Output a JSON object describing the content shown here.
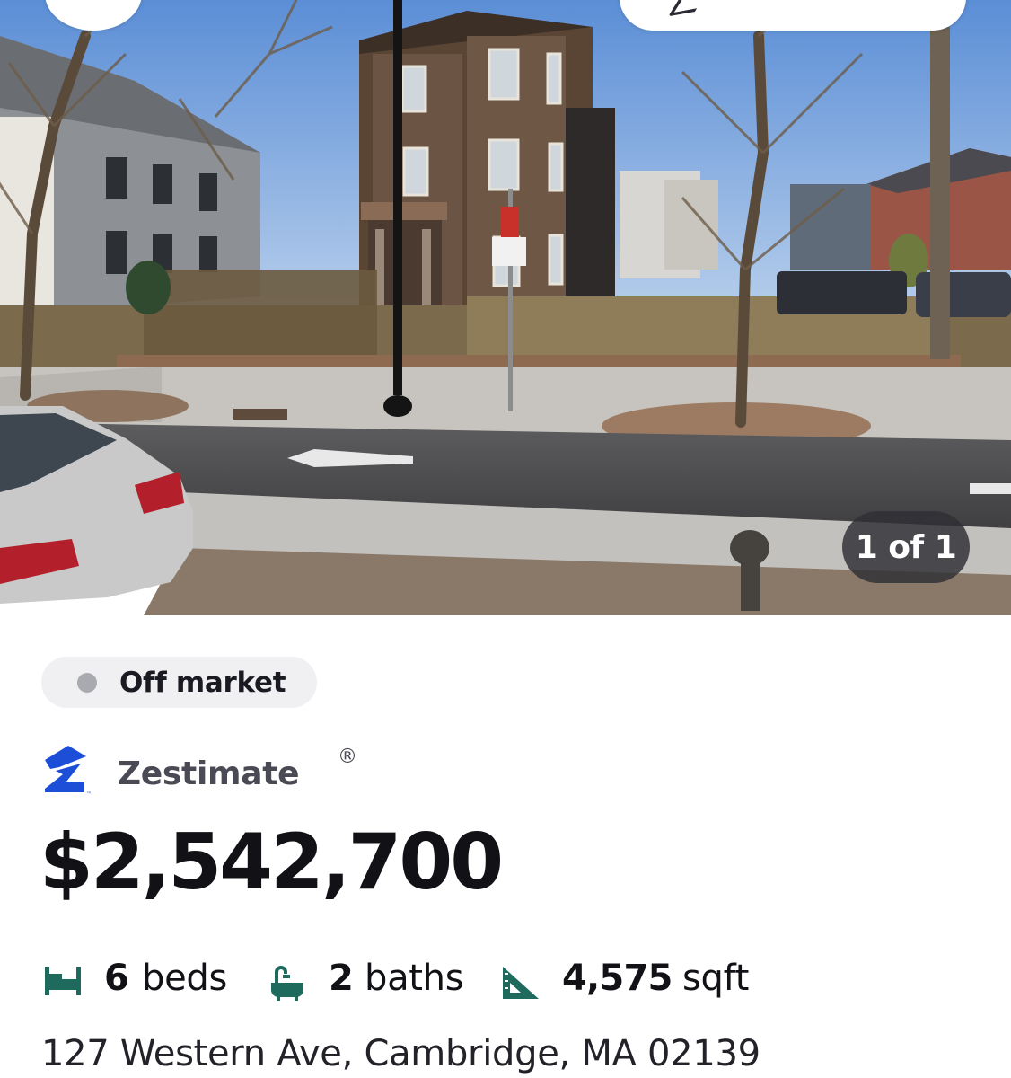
{
  "photo": {
    "counter_text": "1 of 1",
    "description_icon": "listing-photo"
  },
  "status": {
    "label": "Off market",
    "dot_color": "#a9a9b0"
  },
  "zestimate": {
    "label": "Zestimate",
    "registered_mark": "®",
    "logo_icon": "zillow-logo-icon",
    "brand_color": "#1d4ed8"
  },
  "price": "$2,542,700",
  "facts": {
    "icon_color": "#1e6b5e",
    "beds": {
      "value": "6",
      "unit": "beds",
      "icon": "bed-icon"
    },
    "baths": {
      "value": "2",
      "unit": "baths",
      "icon": "bathtub-icon"
    },
    "area": {
      "value": "4,575",
      "unit": "sqft",
      "icon": "ruler-triangle-icon"
    }
  },
  "address": "127 Western Ave, Cambridge, MA 02139"
}
